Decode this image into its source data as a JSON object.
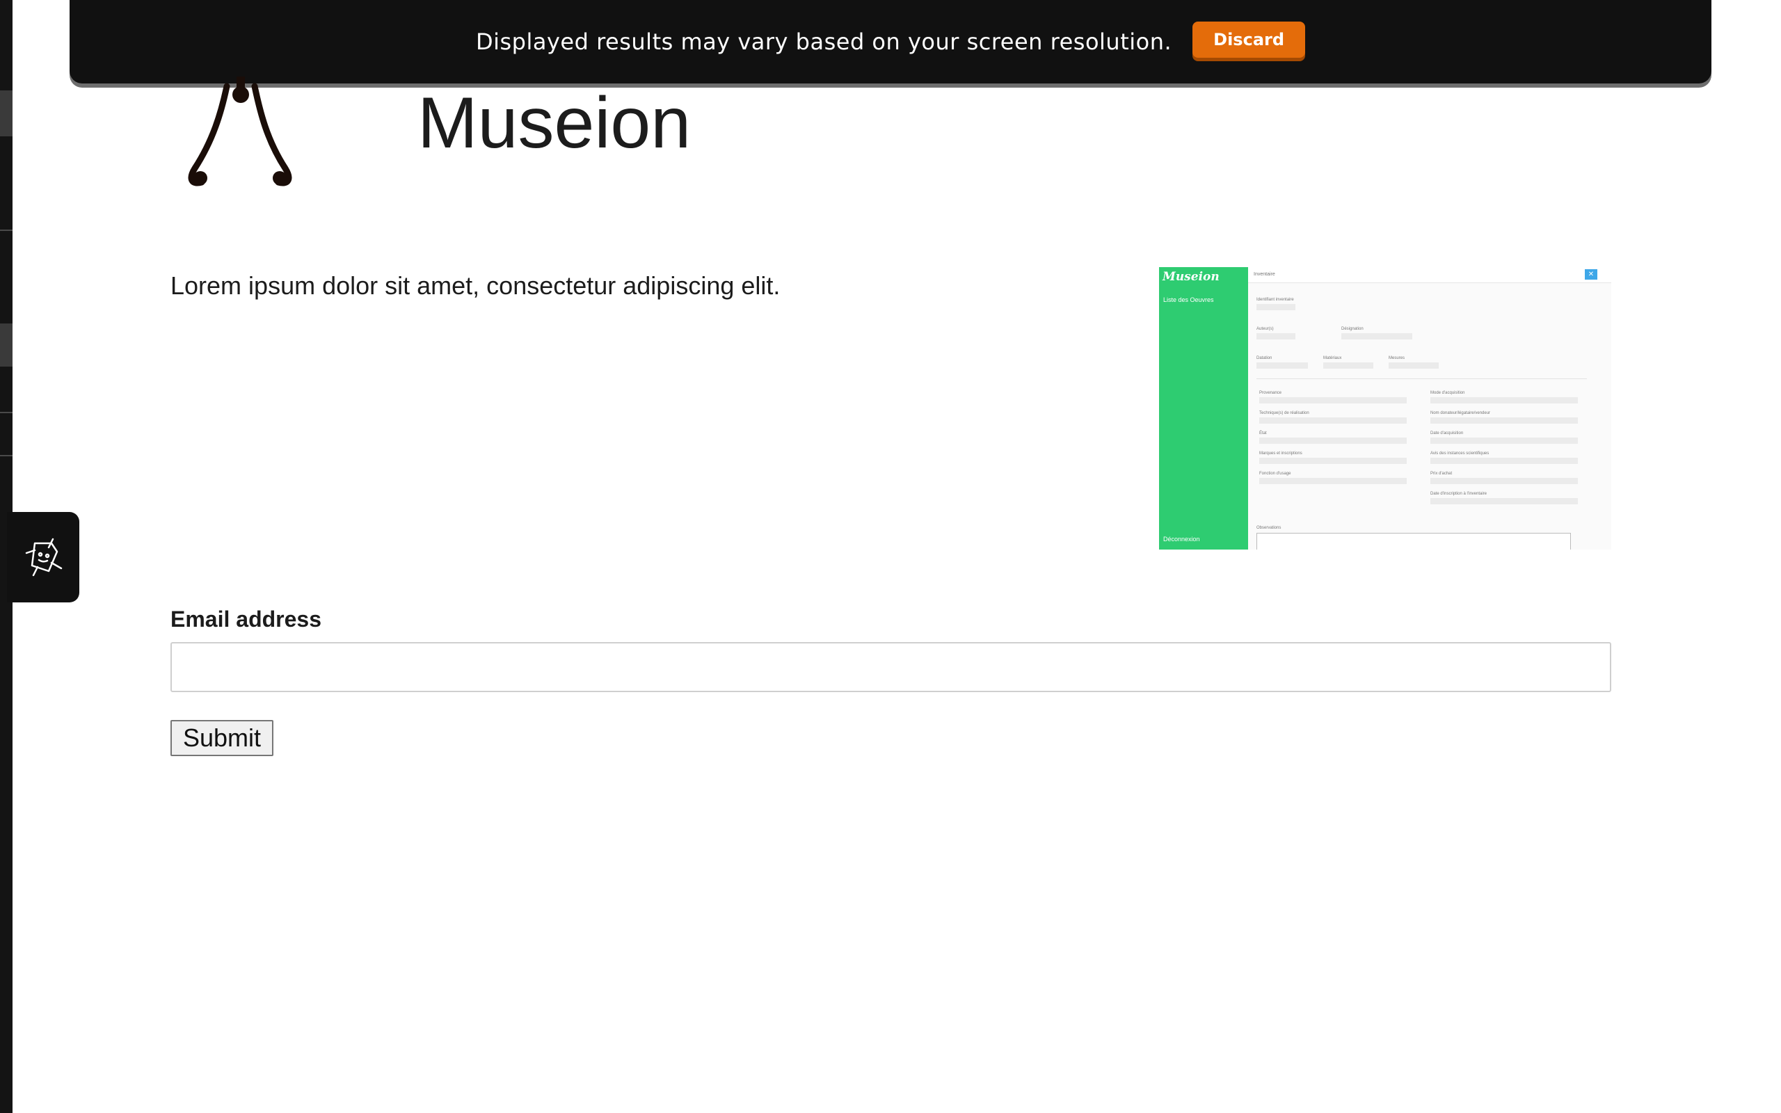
{
  "banner": {
    "message": "Displayed results may vary based on your screen resolution.",
    "discard_label": "Discard"
  },
  "header": {
    "title": "Museion"
  },
  "main": {
    "lead": "Lorem ipsum dolor sit amet, consectetur adipiscing elit."
  },
  "preview": {
    "brand": "Museion",
    "nav_item": "Liste des Oeuvres",
    "logout": "Déconnexion",
    "tab": "Inventaire",
    "close_glyph": "✕",
    "fields_top": [
      "Identifiant inventaire",
      "Auteur(s)",
      "Désignation",
      "Datation",
      "Matériaux",
      "Mesures"
    ],
    "fields_left": [
      "Provenance",
      "Technique(s) de réalisation",
      "État",
      "Marques et inscriptions",
      "Fonction d'usage"
    ],
    "fields_right": [
      "Mode d'acquisition",
      "Nom donateur/légataire/vendeur",
      "Date d'acquisition",
      "Avis des instances scientifiques",
      "Prix d'achat",
      "Date d'inscription à l'inventaire"
    ],
    "observations": "Observations"
  },
  "form": {
    "email_label": "Email address",
    "email_value": "",
    "email_placeholder": "",
    "submit_label": "Submit"
  },
  "colors": {
    "banner_bg": "#111111",
    "discard_bg": "#e46c0a",
    "preview_sidebar": "#2ecc71",
    "preview_close": "#3ea7e8"
  },
  "icons": {
    "logo": "f-hole-scroll-logo",
    "helper": "robot-helper-icon"
  }
}
